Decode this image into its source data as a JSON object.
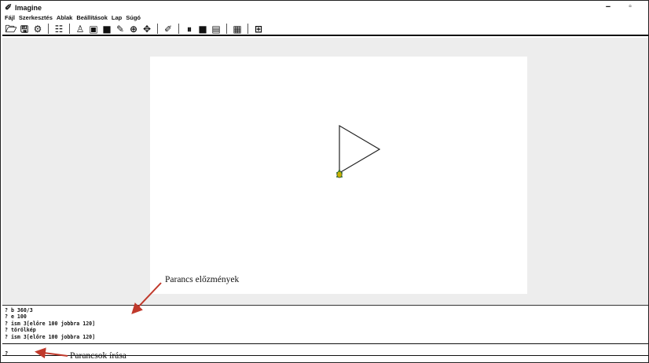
{
  "window": {
    "title": "Imagine",
    "icon": "imagine-logo-icon",
    "controls": {
      "minimize": "−",
      "maximize": "▫",
      "close": "×"
    }
  },
  "menu": {
    "items": [
      {
        "label": "Fájl"
      },
      {
        "label": "Szerkesztés"
      },
      {
        "label": "Ablak"
      },
      {
        "label": "Beállítások"
      },
      {
        "label": "Lap"
      },
      {
        "label": "Súgó"
      }
    ]
  },
  "toolbar": {
    "groups": [
      [
        "open-folder-icon",
        "save-icon",
        "settings-icon"
      ],
      [
        "list-view-icon"
      ],
      [
        "turtle-icon",
        "window-icon",
        "rectangle-icon",
        "pen-icon",
        "target-dropdown-icon",
        "move-dropdown-icon"
      ],
      [
        "imagine-logo-icon"
      ],
      [
        "pause-icon",
        "stop-icon",
        "chart-icon",
        "page-icon"
      ],
      [
        "grid-icon"
      ]
    ]
  },
  "canvas": {
    "background": "#ffffff",
    "workspace_background": "#ededed",
    "drawing": "triangle",
    "turtle_color": "#c8b400"
  },
  "history": {
    "lines": [
      "? b 360/3",
      "? e 100",
      "? ism 3[előre 100 jobbra 120]",
      "? törölkép",
      "? ism 3[előre 100 jobbra 120]"
    ]
  },
  "command": {
    "prompt": "?"
  },
  "annotations": {
    "history_label": "Parancs előzmények",
    "command_label": "Parancsok írása",
    "arrow_color": "#c0392b"
  }
}
